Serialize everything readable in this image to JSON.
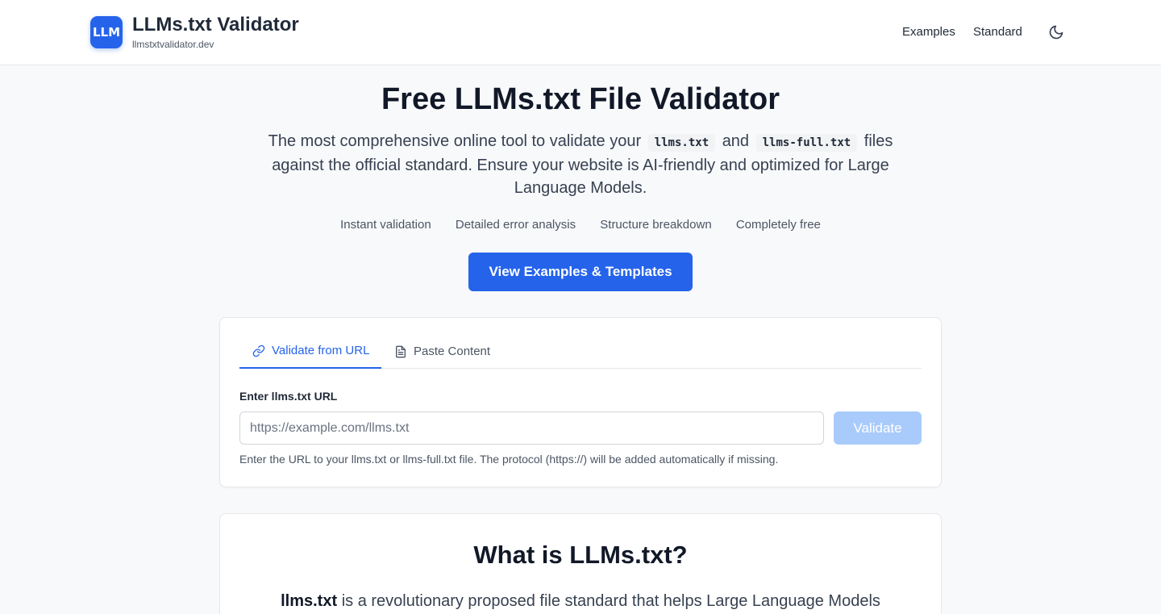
{
  "header": {
    "logo_text": "LLM",
    "title": "LLMs.txt Validator",
    "subtitle": "llmstxtvalidator.dev",
    "nav": {
      "examples": "Examples",
      "standard": "Standard"
    },
    "theme_icon": "moon-icon"
  },
  "hero": {
    "title": "Free LLMs.txt File Validator",
    "desc_part1": "The most comprehensive online tool to validate your",
    "code1": "llms.txt",
    "desc_and": "and",
    "code2": "llms-full.txt",
    "desc_part2": "files against the official standard. Ensure your website is AI-friendly and optimized for Large Language Models.",
    "features": [
      "Instant validation",
      "Detailed error analysis",
      "Structure breakdown",
      "Completely free"
    ],
    "cta_label": "View Examples & Templates"
  },
  "validator": {
    "tabs": [
      {
        "label": "Validate from URL",
        "icon": "link-icon",
        "active": true
      },
      {
        "label": "Paste Content",
        "icon": "document-icon",
        "active": false
      }
    ],
    "field_label": "Enter llms.txt URL",
    "input_value": "",
    "input_placeholder": "https://example.com/llms.txt",
    "validate_label": "Validate",
    "help_text": "Enter the URL to your llms.txt or llms-full.txt file. The protocol (https://) will be added automatically if missing."
  },
  "what_is": {
    "title": "What is LLMs.txt?",
    "text_bold": "llms.txt",
    "text_rest": "is a revolutionary proposed file standard that helps Large Language Models"
  },
  "colors": {
    "accent": "#2563eb",
    "accent_disabled": "#a9cbfb",
    "background": "#f8f9fb"
  }
}
